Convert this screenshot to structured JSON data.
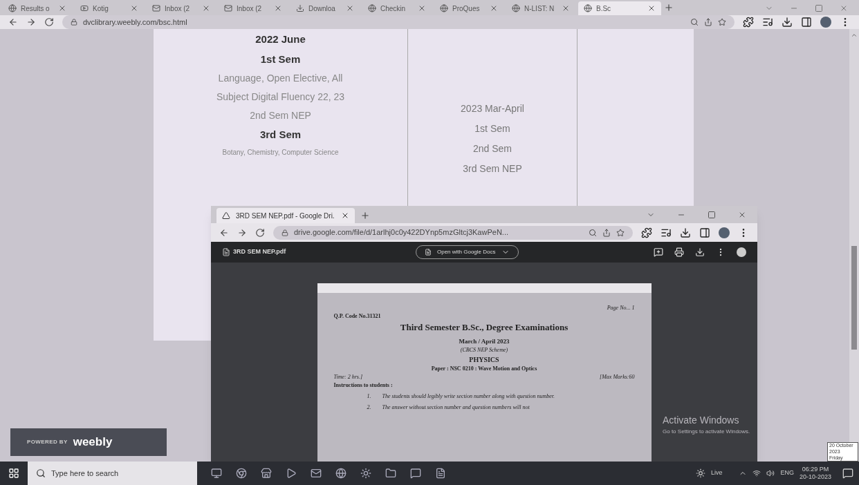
{
  "browser": {
    "tabs": [
      {
        "label": "Results o",
        "selected": false
      },
      {
        "label": "Kotig",
        "selected": false
      },
      {
        "label": "Inbox (2",
        "selected": false
      },
      {
        "label": "Inbox (2",
        "selected": false
      },
      {
        "label": "Downloa",
        "selected": false
      },
      {
        "label": "Checkin",
        "selected": false
      },
      {
        "label": "ProQues",
        "selected": false
      },
      {
        "label": "N-LIST: N",
        "selected": false
      },
      {
        "label": "B.Sc",
        "selected": true
      }
    ],
    "url": "dvclibrary.weebly.com/bsc.html"
  },
  "page": {
    "column_1": [
      {
        "text": "2022 June",
        "bold": true,
        "small": false
      },
      {
        "text": "1st Sem",
        "bold": true,
        "small": false
      },
      {
        "text": "Language,  Open Elective, All",
        "bold": false,
        "small": false
      },
      {
        "text": "Subject Digital Fluency 22, 23",
        "bold": false,
        "small": false
      },
      {
        "text": "2nd Sem NEP",
        "bold": false,
        "small": false
      },
      {
        "text": "3rd Sem",
        "bold": true,
        "small": false
      },
      {
        "text": "Botany, Chemistry, Computer Science",
        "bold": false,
        "small": true
      }
    ],
    "column_2": [
      "2023 Mar-April",
      "1st Sem",
      "2nd Sem",
      "3rd Sem NEP"
    ],
    "footer_badge": {
      "prefix": "POWERED BY",
      "brand": "weebly"
    }
  },
  "popup_window": {
    "tab": "3RD SEM NEP.pdf - Google Dri.",
    "url": "drive.google.com/file/d/1arlhj0c0y422DYnp5mzGltcj3KawPeN...",
    "file_name": "3RD SEM NEP.pdf",
    "open_with": "Open with Google Docs",
    "document": {
      "page_no": "Page No... 1",
      "code": "Q.P. Code No.31321",
      "title": "Third Semester B.Sc., Degree Examinations",
      "session": "March / April  2023",
      "scheme": "(CBCS NEP  Scheme)",
      "subject": "PHYSICS",
      "paper": "Paper : NSC 0210 : Wave Motion and Optics",
      "time": "Time: 2 hrs.]",
      "max_marks": "[Max Marks:60",
      "instructions": "Instructions  to students :",
      "items": [
        {
          "num": "1.",
          "text": "The students should legibly write section number along with question number."
        },
        {
          "num": "2.",
          "text": "The answer without section number and question numbers will not"
        }
      ]
    }
  },
  "activation": {
    "title": "Activate Windows",
    "subtitle": "Go to Settings to activate Windows."
  },
  "date_tooltip": {
    "date": "20 October 2023",
    "day": "Friday"
  },
  "taskbar": {
    "search_placeholder": "Type here to search",
    "weather": "Live",
    "language": "ENG",
    "time": "06:29 PM",
    "date": "20-10-2023"
  }
}
